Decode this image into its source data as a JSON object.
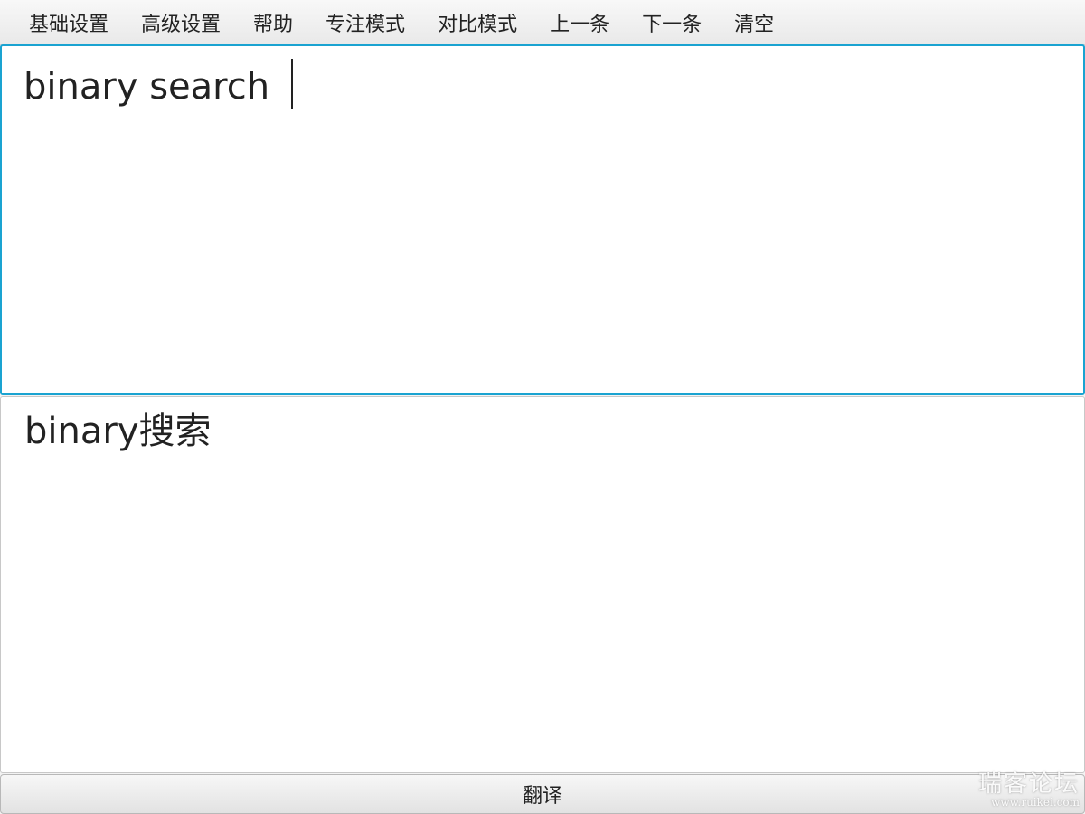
{
  "menu": {
    "items": [
      {
        "label": "基础设置"
      },
      {
        "label": "高级设置"
      },
      {
        "label": "帮助"
      },
      {
        "label": "专注模式"
      },
      {
        "label": "对比模式"
      },
      {
        "label": "上一条"
      },
      {
        "label": "下一条"
      },
      {
        "label": "清空"
      }
    ]
  },
  "input": {
    "value": "binary search"
  },
  "output": {
    "value": "binary搜索"
  },
  "actions": {
    "translate_label": "翻译"
  },
  "watermark": {
    "title": "瑞客论坛",
    "url": "www.ruikei.com"
  },
  "colors": {
    "focus_border": "#1aa3d1",
    "background": "#f3f3f3"
  }
}
